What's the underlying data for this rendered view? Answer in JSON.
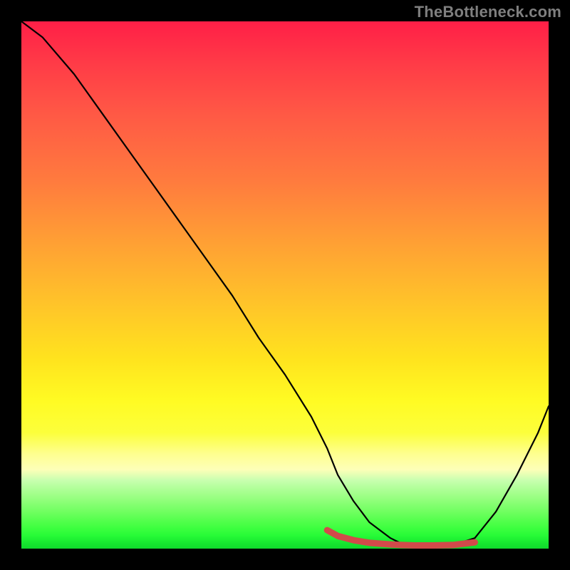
{
  "watermark": "TheBottleneck.com",
  "chart_data": {
    "type": "line",
    "title": "",
    "xlabel": "",
    "ylabel": "",
    "xlim": [
      0,
      100
    ],
    "ylim": [
      0,
      100
    ],
    "grid": false,
    "legend": false,
    "series": [
      {
        "name": "main-curve",
        "color": "#000000",
        "x": [
          0,
          4,
          10,
          15,
          20,
          25,
          30,
          35,
          40,
          45,
          50,
          55,
          58,
          60,
          63,
          66,
          70,
          72,
          75,
          78,
          82,
          86,
          90,
          94,
          98,
          100
        ],
        "values": [
          100,
          97,
          90,
          83,
          76,
          69,
          62,
          55,
          48,
          40,
          33,
          25,
          19,
          14,
          9,
          5,
          2,
          1,
          0.6,
          0.6,
          0.7,
          2,
          7,
          14,
          22,
          27
        ]
      },
      {
        "name": "bottom-band",
        "color": "#d24a4a",
        "x": [
          58,
          60,
          63,
          66,
          70,
          72,
          75,
          78,
          82,
          86
        ],
        "values": [
          3.5,
          2.4,
          1.6,
          1.1,
          0.8,
          0.7,
          0.6,
          0.6,
          0.7,
          1.2
        ]
      }
    ],
    "gradient_stops": [
      {
        "pos": 0,
        "color": "#ff1f47"
      },
      {
        "pos": 0.3,
        "color": "#ff7a3e"
      },
      {
        "pos": 0.54,
        "color": "#ffc529"
      },
      {
        "pos": 0.78,
        "color": "#fcff3b"
      },
      {
        "pos": 0.87,
        "color": "#c9ffb0"
      },
      {
        "pos": 0.93,
        "color": "#70ff60"
      },
      {
        "pos": 1.0,
        "color": "#10d92c"
      }
    ]
  }
}
